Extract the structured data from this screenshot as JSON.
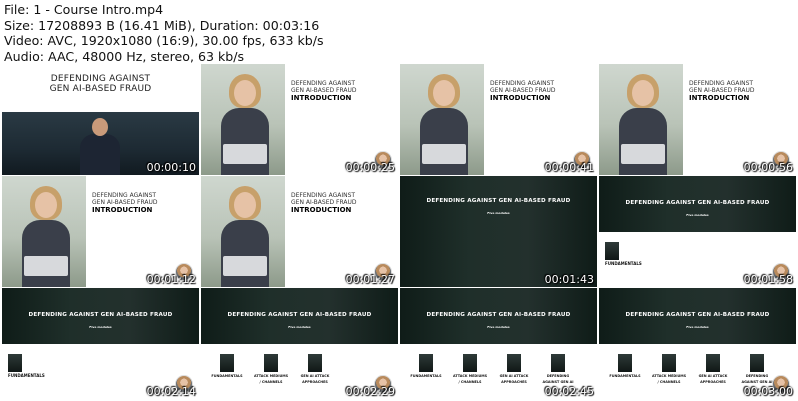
{
  "header": {
    "file_line": "File: 1 - Course Intro.mp4",
    "size_line": "Size: 17208893 B (16.41 MiB), Duration: 00:03:16",
    "video_line": "Video: AVC, 1920x1080 (16:9), 30.00 fps, 633 kb/s",
    "audio_line": "Audio: AAC, 48000 Hz, stereo, 63 kb/s"
  },
  "slides": {
    "title_top": "DEFENDING AGAINST",
    "title_bottom": "GEN AI-BASED FRAUD",
    "intro_h1a": "DEFENDING AGAINST",
    "intro_h1b": "GEN AI-BASED FRAUD",
    "intro_h2": "INTRODUCTION",
    "modules_title": "DEFENDING AGAINST GEN AI-BASED FRAUD",
    "modules_count": "Five modules",
    "card_1": "FUNDAMENTALS",
    "card_2a": "ATTACK MEDIUMS",
    "card_2b": "/ CHANNELS",
    "card_3a": "GEN AI ATTACK",
    "card_3b": "APPROACHES",
    "card_4a": "DEFENDING",
    "card_4b": "AGAINST GEN AI"
  },
  "timestamps": [
    "00:00:10",
    "00:00:25",
    "00:00:41",
    "00:00:56",
    "00:01:12",
    "00:01:27",
    "00:01:43",
    "00:01:58",
    "00:02:14",
    "00:02:29",
    "00:02:45",
    "00:03:00"
  ]
}
